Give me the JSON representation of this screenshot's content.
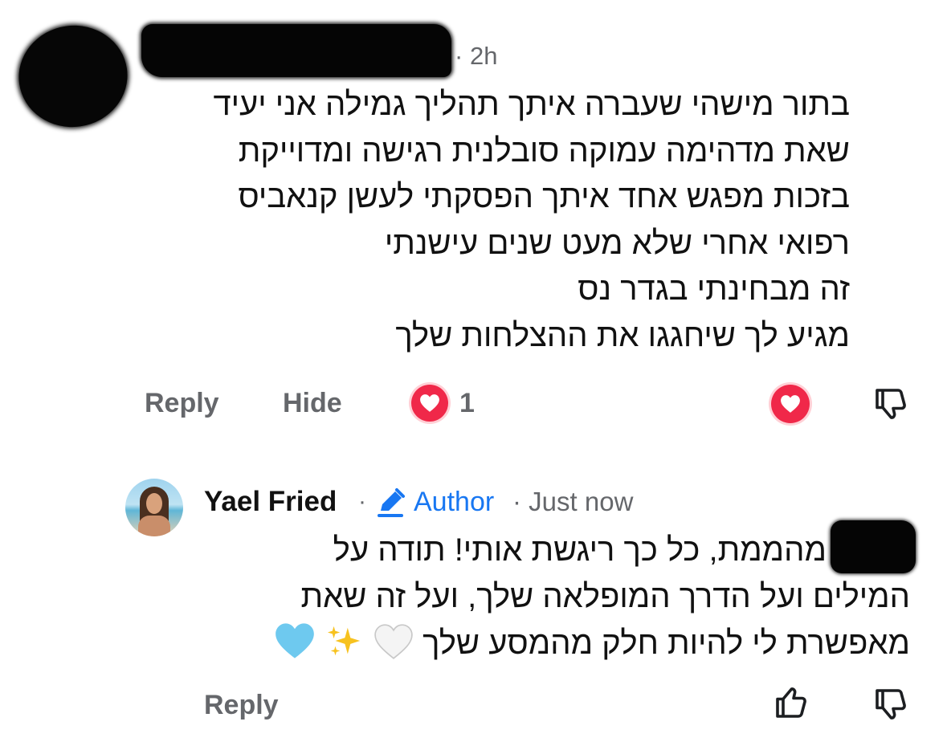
{
  "comment": {
    "timestamp": "2h",
    "separator": "·",
    "lines": [
      "בתור מישהי שעברה איתך תהליך גמילה אני יעיד",
      "שאת מדהימה עמוקה סובלנית רגישה ומדוייקת",
      "בזכות מפגש אחד איתך הפסקתי לעשן קנאביס",
      "רפואי אחרי שלא מעט שנים עישנתי",
      "זה מבחינתי בגדר נס",
      "מגיע לך שיחגגו את ההצלחות שלך"
    ],
    "actions": {
      "reply": "Reply",
      "hide": "Hide"
    },
    "reaction_count": "1",
    "reaction_icon": "heart-icon",
    "colors": {
      "meta": "#65676b",
      "reaction": "#f02849"
    }
  },
  "reply": {
    "author": "Yael Fried",
    "separator": "·",
    "badge": "Author",
    "badge_icon": "pencil-icon",
    "timestamp": "Just now",
    "lines": [
      "מהממת, כל כך ריגשת אותי! תודה על",
      "המילים ועל הדרך המופלאה שלך, ועל זה שאת",
      "מאפשרת לי להיות חלק מהמסע שלך"
    ],
    "emojis": [
      "🤍",
      "✨",
      "🩵"
    ],
    "actions": {
      "reply": "Reply"
    },
    "colors": {
      "author_badge": "#1877f2"
    }
  }
}
